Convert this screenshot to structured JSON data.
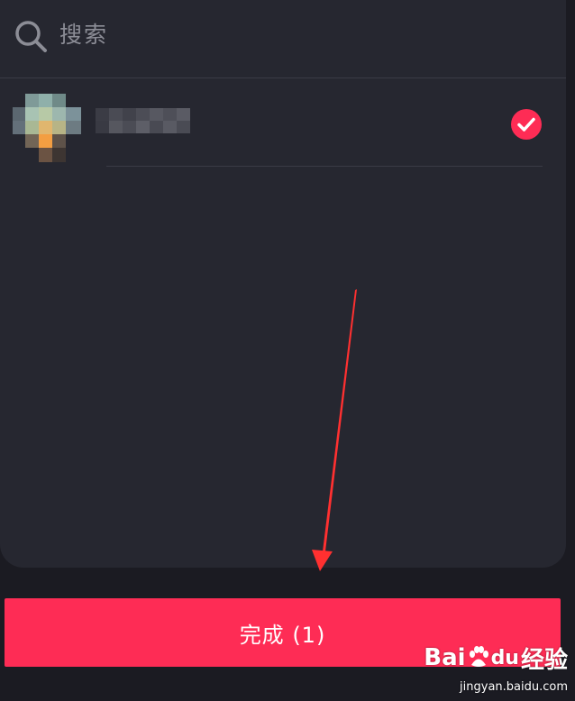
{
  "search": {
    "placeholder": "搜索"
  },
  "contact": {
    "selected": true
  },
  "done_button": {
    "label": "完成 (1)"
  },
  "watermark": {
    "brand": "Bai",
    "brand_suffix": "du",
    "brand_cn": "经验",
    "url": "jingyan.baidu.com"
  },
  "colors": {
    "accent": "#fe2c55",
    "panel": "#262730",
    "background": "#1b1b22",
    "annotation_arrow": "#ff3030"
  },
  "icons": {
    "search": "search-icon",
    "selected": "check-circle-icon"
  }
}
